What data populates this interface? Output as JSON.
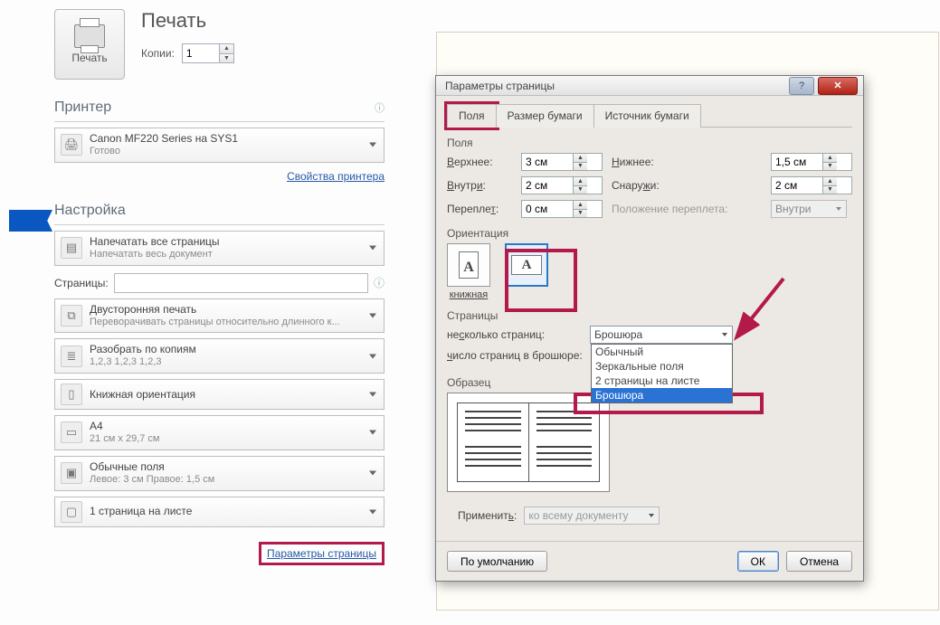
{
  "print": {
    "title": "Печать",
    "button": "Печать",
    "copies_label": "Копии:",
    "copies_value": "1",
    "printer_heading": "Принтер",
    "printer_name": "Canon MF220 Series на SYS1",
    "printer_status": "Готово",
    "printer_props": "Свойства принтера",
    "settings_heading": "Настройка",
    "opt_allpages": "Напечатать все страницы",
    "opt_allpages_sub": "Напечатать весь документ",
    "pages_label": "Страницы:",
    "opt_duplex": "Двусторонняя печать",
    "opt_duplex_sub": "Переворачивать страницы относительно длинного к...",
    "opt_collate": "Разобрать по копиям",
    "opt_collate_sub": "1,2,3   1,2,3   1,2,3",
    "opt_orient": "Книжная ориентация",
    "opt_paper": "A4",
    "opt_paper_sub": "21 см x 29,7 см",
    "opt_margins": "Обычные поля",
    "opt_margins_sub": "Левое: 3 см   Правое: 1,5 см",
    "opt_ppsheet": "1 страница на листе",
    "page_setup_link": "Параметры страницы"
  },
  "dialog": {
    "title": "Параметры страницы",
    "tabs": {
      "margins": "Поля",
      "paper": "Размер бумаги",
      "source": "Источник бумаги"
    },
    "grp_margins": "Поля",
    "m_top": "Верхнее:",
    "m_top_u": "В",
    "m_top_v": "3 см",
    "m_bottom": "Нижнее:",
    "m_bottom_u": "Н",
    "m_bottom_v": "1,5 см",
    "m_inside": "Внутри:",
    "m_inside_u": "В",
    "m_inside_v": "2 см",
    "m_outside": "Снаружи:",
    "m_outside_u": "С",
    "m_outside_v": "2 см",
    "m_gutter": "Переплет:",
    "m_gutter_v": "0 см",
    "m_gutterpos": "Положение переплета:",
    "m_gutterpos_v": "Внутри",
    "grp_orient": "Ориентация",
    "orient_port": "книжная",
    "orient_land": "",
    "grp_pages": "Страницы",
    "multi_label": "несколько страниц:",
    "multi_value": "Брошюра",
    "multi_options": [
      "Обычный",
      "Зеркальные поля",
      "2 страницы на листе",
      "Брошюра"
    ],
    "sheets_label": "число страниц в брошюре:",
    "grp_sample": "Образец",
    "apply_label": "Применить:",
    "apply_value": "ко всему документу",
    "btn_default": "По умолчанию",
    "btn_ok": "ОК",
    "btn_cancel": "Отмена"
  }
}
